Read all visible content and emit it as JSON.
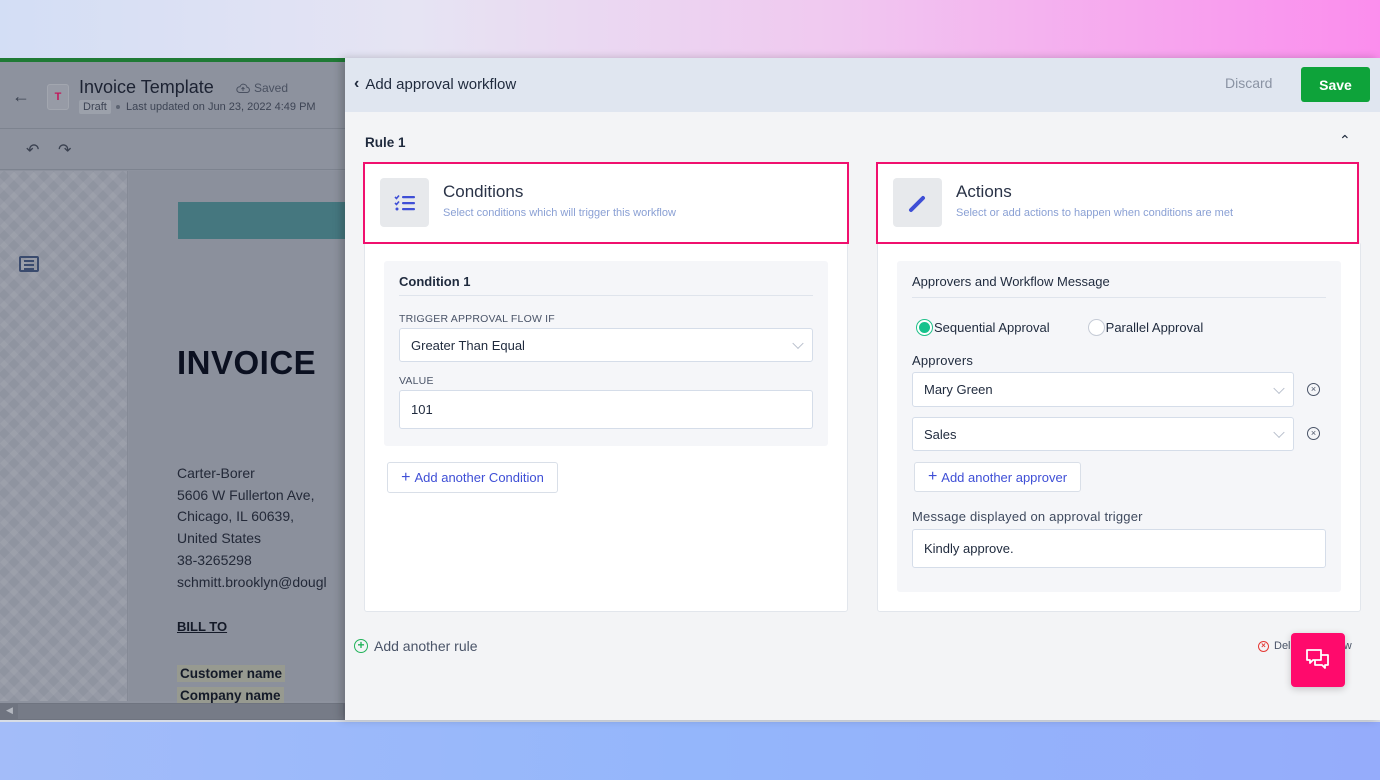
{
  "editor": {
    "doc_badge": "T",
    "title": "Invoice Template",
    "save_status": "Saved",
    "status_tag": "Draft",
    "last_updated": "Last updated on Jun 23, 2022 4:49 PM",
    "invoice_heading": "INVOICE",
    "address_lines": [
      "Carter-Borer",
      "5606 W Fullerton Ave,",
      "Chicago, IL 60639,",
      "United States",
      "38-3265298",
      "schmitt.brooklyn@dougl"
    ],
    "bill_to": "BILL TO",
    "customer_name": "Customer name",
    "company_name": "Company name"
  },
  "panel": {
    "title": "Add approval workflow",
    "discard_label": "Discard",
    "save_label": "Save",
    "rule_title": "Rule 1",
    "conditions": {
      "title": "Conditions",
      "subtitle": "Select conditions which will trigger this workflow",
      "condition_title": "Condition 1",
      "trigger_label": "TRIGGER APPROVAL FLOW IF",
      "trigger_value": "Greater Than Equal",
      "value_label": "VALUE",
      "value": "101",
      "add_condition_label": "Add another Condition"
    },
    "actions": {
      "title": "Actions",
      "subtitle": "Select or add actions to happen when conditions are met",
      "section_title": "Approvers and Workflow Message",
      "approval_modes": [
        {
          "label": "Sequential Approval",
          "selected": true
        },
        {
          "label": "Parallel Approval",
          "selected": false
        }
      ],
      "approvers_label": "Approvers",
      "approvers": [
        "Mary Green",
        "Sales"
      ],
      "add_approver_label": "Add another approver",
      "message_label": "Message displayed on approval trigger",
      "message_value": "Kindly approve."
    },
    "add_rule_label": "Add another rule",
    "delete_workflow_label": "Delete workflow"
  },
  "colors": {
    "highlight_border": "#f0106e",
    "save_green": "#0ea33a",
    "link_blue": "#3f4fd6",
    "radio_green": "#15c28c",
    "chat_fab": "#ff0a6c"
  }
}
